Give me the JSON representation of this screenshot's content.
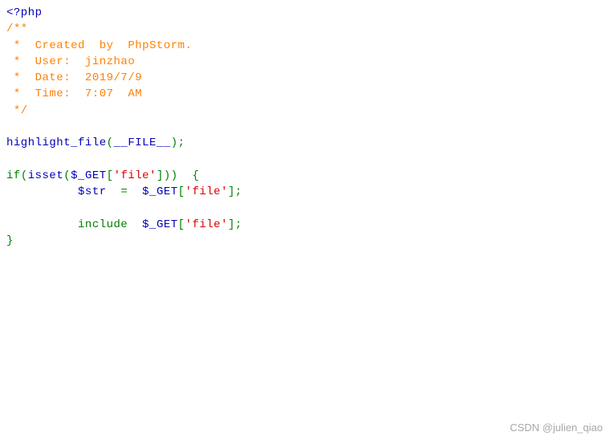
{
  "code": {
    "php_open": "<?php",
    "comment_open": "/**",
    "comment_l1": " *  Created  by  PhpStorm.",
    "comment_l2": " *  User:  jinzhao",
    "comment_l3": " *  Date:  2019/7/9",
    "comment_l4": " *  Time:  7:07  AM",
    "comment_close": " */",
    "fn_highlight": "highlight_file",
    "const_file": "__FILE__",
    "kw_if": "if",
    "fn_isset": "isset",
    "var_get": "$_GET",
    "str_file": "'file'",
    "var_str": "$str",
    "op_assign": "=",
    "kw_include": "include",
    "paren_open": "(",
    "paren_close": ")",
    "bracket_open": "[",
    "bracket_close": "]",
    "brace_open": "{",
    "brace_close": "}",
    "semicolon": ";",
    "sp": "  ",
    "sp8": "        ",
    "sp10": "          "
  },
  "watermark": "CSDN @julien_qiao"
}
